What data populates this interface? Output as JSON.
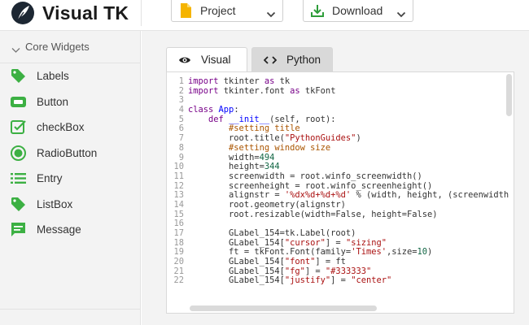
{
  "app": {
    "title": "Visual TK"
  },
  "toolbar": {
    "project_label": "Project",
    "download_label": "Download"
  },
  "sidebar": {
    "section_title": "Core Widgets",
    "items": [
      {
        "label": "Labels",
        "icon": "tag-icon"
      },
      {
        "label": "Button",
        "icon": "button-icon"
      },
      {
        "label": "checkBox",
        "icon": "checkbox-icon"
      },
      {
        "label": "RadioButton",
        "icon": "radio-icon"
      },
      {
        "label": "Entry",
        "icon": "list-icon"
      },
      {
        "label": "ListBox",
        "icon": "tag-icon"
      },
      {
        "label": "Message",
        "icon": "message-icon"
      }
    ]
  },
  "tabs": [
    {
      "label": "Visual",
      "icon": "eye-icon",
      "active": false
    },
    {
      "label": "Python",
      "icon": "code-icon",
      "active": true
    }
  ],
  "editor": {
    "language": "Python",
    "lines": [
      "import tkinter as tk",
      "import tkinter.font as tkFont",
      "",
      "class App:",
      "    def __init__(self, root):",
      "        #setting title",
      "        root.title(\"PythonGuides\")",
      "        #setting window size",
      "        width=494",
      "        height=344",
      "        screenwidth = root.winfo_screenwidth()",
      "        screenheight = root.winfo_screenheight()",
      "        alignstr = '%dx%d+%d+%d' % (width, height, (screenwidth",
      "        root.geometry(alignstr)",
      "        root.resizable(width=False, height=False)",
      "",
      "        GLabel_154=tk.Label(root)",
      "        GLabel_154[\"cursor\"] = \"sizing\"",
      "        ft = tkFont.Font(family='Times',size=10)",
      "        GLabel_154[\"font\"] = ft",
      "        GLabel_154[\"fg\"] = \"#333333\"",
      "        GLabel_154[\"justify\"] = \"center\""
    ]
  },
  "colors": {
    "accent_green": "#3cb043",
    "sidebar_bg": "#f3f3f3",
    "download_green": "#2e9d3a",
    "project_yellow": "#f5b400"
  }
}
